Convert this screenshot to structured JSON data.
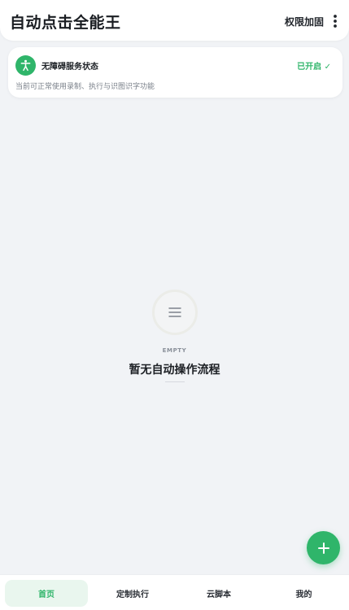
{
  "header": {
    "title": "自动点击全能王",
    "action_label": "权限加固",
    "more_icon": "more-vertical-icon"
  },
  "status_card": {
    "icon": "accessibility-icon",
    "title": "无障碍服务状态",
    "state": "已开启 ✓",
    "description": "当前可正常使用录制、执行与识图识字功能"
  },
  "empty_state": {
    "icon": "list-lines-icon",
    "tag": "EMPTY",
    "title": "暂无自动操作流程"
  },
  "fab": {
    "icon": "plus-icon"
  },
  "bottom_nav": {
    "items": [
      {
        "label": "首页",
        "active": true
      },
      {
        "label": "定制执行",
        "active": false
      },
      {
        "label": "云脚本",
        "active": false
      },
      {
        "label": "我的",
        "active": false
      }
    ]
  },
  "colors": {
    "accent": "#2fb56a",
    "background": "#f1f3f6",
    "surface": "#ffffff"
  }
}
